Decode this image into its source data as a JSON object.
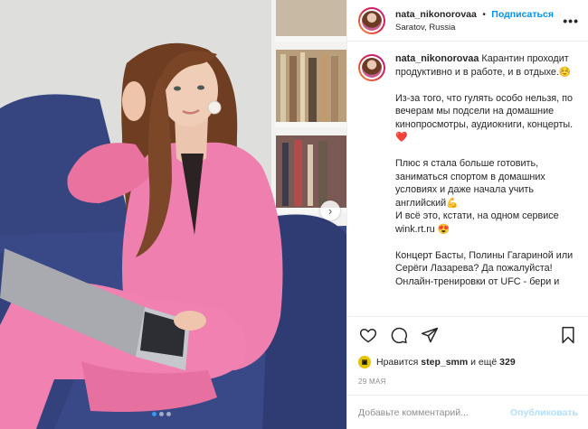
{
  "post": {
    "username": "nata_nikonorovaa",
    "separator": "•",
    "follow_label": "Подписаться",
    "location": "Saratov, Russia",
    "more_label": "•••"
  },
  "caption": {
    "username": "nata_nikonorovaa",
    "paragraphs": [
      "Карантин проходит продуктивно и в работе, и в отдыхе.☺️",
      "Из-за того, что гулять особо нельзя, по вечерам мы подсели на домашние кинопросмотры, аудиокниги, концерты.❤️",
      "Плюс я стала больше готовить, заниматься спортом в домашних условиях и даже начала учить английский💪",
      "И всё это, кстати, на одном сервисе wink.rt.ru 😍",
      "Концерт Басты, Полины Гагариной или Серёги Лазарева? Да пожалуйста!",
      "Онлайн-тренировки от UFC - бери и"
    ]
  },
  "likes": {
    "prefix": "Нравится",
    "user": "step_smm",
    "middle": "и ещё",
    "count": "329"
  },
  "date": "29 МАЯ",
  "comment_input": {
    "placeholder": "Добавьте комментарий..."
  },
  "publish_label": "Опубликовать",
  "carousel": {
    "next_label": "›",
    "slide_count": 3,
    "active_slide": 1
  },
  "colors": {
    "accent": "#0095f6",
    "suit": "#ef7fae",
    "sofa": "#3b4a88"
  },
  "icons": [
    "heart-icon",
    "comment-icon",
    "share-icon",
    "bookmark-icon",
    "more-icon",
    "chevron-right-icon"
  ]
}
